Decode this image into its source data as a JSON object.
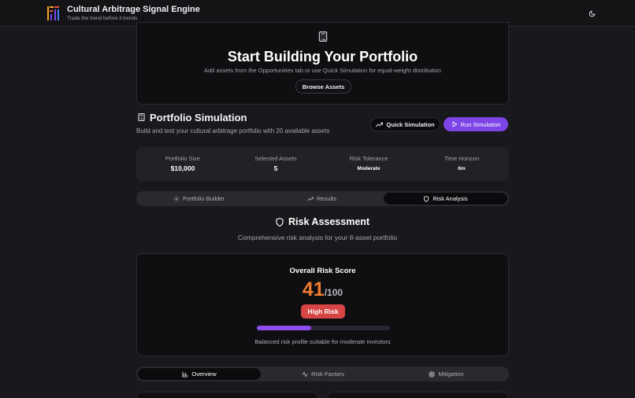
{
  "header": {
    "app_title": "Cultural Arbitrage Signal Engine",
    "app_subtitle": "Trade the trend before it trends",
    "theme_icon": "moon-icon",
    "logo_colors": [
      "#f5a623",
      "#e8553d",
      "#7d45e8",
      "#3b82f6"
    ]
  },
  "hero": {
    "icon": "calculator-icon",
    "title": "Start Building Your Portfolio",
    "description": "Add assets from the Opportunities tab or use Quick Simulation for equal-weight distribution",
    "browse_label": "Browse Assets"
  },
  "simulation": {
    "icon": "calculator-icon",
    "title": "Portfolio Simulation",
    "description": "Build and test your cultural arbitrage portfolio with 20 available assets",
    "quick_label": "Quick Simulation",
    "run_label": "Run Simulation",
    "run_color": "#7d45e8"
  },
  "stats": [
    {
      "label": "Portfolio Size",
      "value": "$10,000"
    },
    {
      "label": "Selected Assets",
      "value": "5"
    },
    {
      "label": "Risk Tolerance",
      "value": "Moderate"
    },
    {
      "label": "Time Horizon",
      "value": "6m"
    }
  ],
  "main_tabs": [
    {
      "label": "Portfolio Builder",
      "icon": "gear-icon",
      "active": false
    },
    {
      "label": "Results",
      "icon": "trending-up-icon",
      "active": false
    },
    {
      "label": "Risk Analysis",
      "icon": "shield-icon",
      "active": true
    }
  ],
  "risk": {
    "title": "Risk Assessment",
    "description": "Comprehensive risk analysis for your 8-asset portfolio",
    "score_title": "Overall Risk Score",
    "score": "41",
    "score_max": "/100",
    "score_fraction": 0.41,
    "badge": "High Risk",
    "badge_color": "#d84545",
    "score_color": "#f07a2f",
    "caption": "Balanced risk profile suitable for moderate investors"
  },
  "risk_tabs": [
    {
      "label": "Overview",
      "icon": "bar-chart-icon",
      "active": true
    },
    {
      "label": "Risk Factors",
      "icon": "activity-icon",
      "active": false
    },
    {
      "label": "Mitigation",
      "icon": "target-icon",
      "active": false
    }
  ]
}
